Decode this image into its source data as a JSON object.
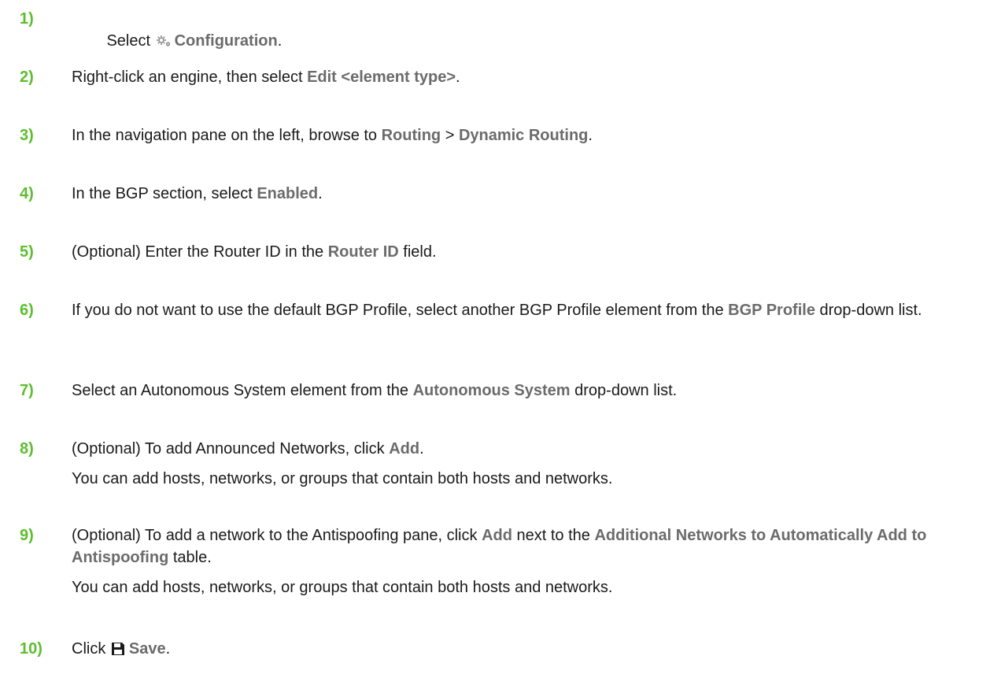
{
  "colors": {
    "step_number": "#5cbe2e",
    "ui_term": "#6b6b6b",
    "text": "#1a1a1a"
  },
  "steps": [
    {
      "number": "1)",
      "parts": [
        "Select ",
        "Configuration",
        "."
      ],
      "icon": "gears-icon"
    },
    {
      "number": "2)",
      "parts": [
        "Right-click an engine, then select ",
        "Edit <element type>",
        "."
      ]
    },
    {
      "number": "3)",
      "parts": [
        "In the navigation pane on the left, browse to ",
        "Routing",
        " > ",
        "Dynamic Routing",
        "."
      ]
    },
    {
      "number": "4)",
      "parts": [
        "In the BGP section, select ",
        "Enabled",
        "."
      ]
    },
    {
      "number": "5)",
      "parts": [
        "(Optional) Enter the Router ID in the ",
        "Router ID",
        " field."
      ]
    },
    {
      "number": "6)",
      "parts": [
        "If you do not want to use the default BGP Profile, select another BGP Profile element from the ",
        "BGP Profile",
        " drop-down list."
      ]
    },
    {
      "number": "7)",
      "parts": [
        "Select an Autonomous System element from the ",
        "Autonomous System",
        " drop-down list."
      ]
    },
    {
      "number": "8)",
      "parts": [
        "(Optional) To add Announced Networks, click ",
        "Add",
        "."
      ],
      "note": "You can add hosts, networks, or groups that contain both hosts and networks."
    },
    {
      "number": "9)",
      "parts": [
        "(Optional) To add a network to the Antispoofing pane, click ",
        "Add",
        " next to the ",
        "Additional Networks to Automatically Add to Antispoofing",
        " table."
      ],
      "note": "You can add hosts, networks, or groups that contain both hosts and networks."
    },
    {
      "number": "10)",
      "parts": [
        "Click ",
        "Save",
        "."
      ],
      "icon": "save-icon"
    }
  ]
}
